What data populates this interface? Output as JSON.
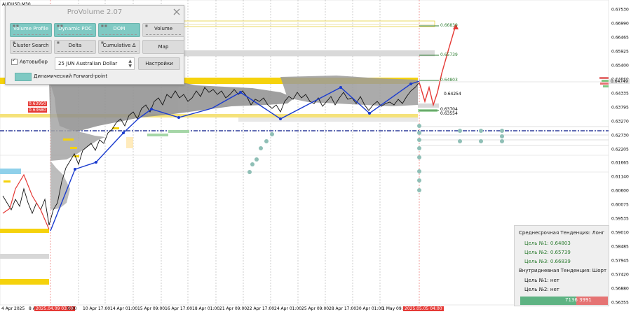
{
  "symbol": "AUDUSD,M30",
  "y_axis": [
    "0.67530",
    "0.66990",
    "0.66465",
    "0.65925",
    "0.65400",
    "0.64860",
    "0.64335",
    "0.63795",
    "0.63270",
    "0.62730",
    "0.62205",
    "0.61665",
    "0.61140",
    "0.60600",
    "0.60075",
    "0.59535",
    "0.59010",
    "0.58485",
    "0.57945",
    "0.57420",
    "0.56880",
    "0.56355"
  ],
  "x_axis": [
    "4 Apr 2025",
    "8 Apr",
    "2025.04.09 03:00",
    "9:00",
    "10 Apr 17:00",
    "14 Apr 01:00",
    "15 Apr 09:00",
    "16 Apr 17:00",
    "18 Apr 01:00",
    "21 Apr 09:00",
    "22 Apr 17:00",
    "24 Apr 01:00",
    "25 Apr 09:00",
    "28 Apr 17:00",
    "30 Apr 01:00",
    "1 May 09:00",
    "2025.05.05 04:00"
  ],
  "current_price": "0.64749",
  "level_labels": {
    "left_a": "0.63950",
    "left_b": "0.63680",
    "t3": "0.66839",
    "t2": "0.65739",
    "t1": "0.64803",
    "r1": "0.64254",
    "r2": "0.63704",
    "r3": "0.63554"
  },
  "panel": {
    "title": "ProVolume 2.07",
    "buttons": {
      "volume_profile": "Volume Profile",
      "dynamic_poc": "Dynamic POC",
      "dom": "DOM",
      "volume": "Volume",
      "cluster_search": "Cluster Search",
      "delta": "Delta",
      "cumulative_delta": "Cumulative Δ",
      "map": "Map",
      "settings": "Настройки"
    },
    "auto_select_label": "Автовыбор",
    "auto_select_checked": true,
    "contract_value": "25 JUN Australian Dollar",
    "forward_point_label": "Динамический Forward-point"
  },
  "tendency": {
    "mid_title": "Среднесрочная Тенденция: Лонг",
    "mid_targets": [
      "Цель №1: 0.64803",
      "Цель №2: 0.65739",
      "Цель №3: 0.66839"
    ],
    "intraday_title": "Внутридневная Тенденция: Шорт",
    "intraday_targets": [
      "Цель №1: нет",
      "Цель №2: нет"
    ]
  },
  "volumes": {
    "buy": "7136",
    "sell": "3991"
  },
  "colors": {
    "accent": "#7fc9c3",
    "trend_blue": "#1a3bcf",
    "forecast_red": "#e53935",
    "level_yellow": "#f5d20c",
    "target_green": "#2e7d32"
  }
}
